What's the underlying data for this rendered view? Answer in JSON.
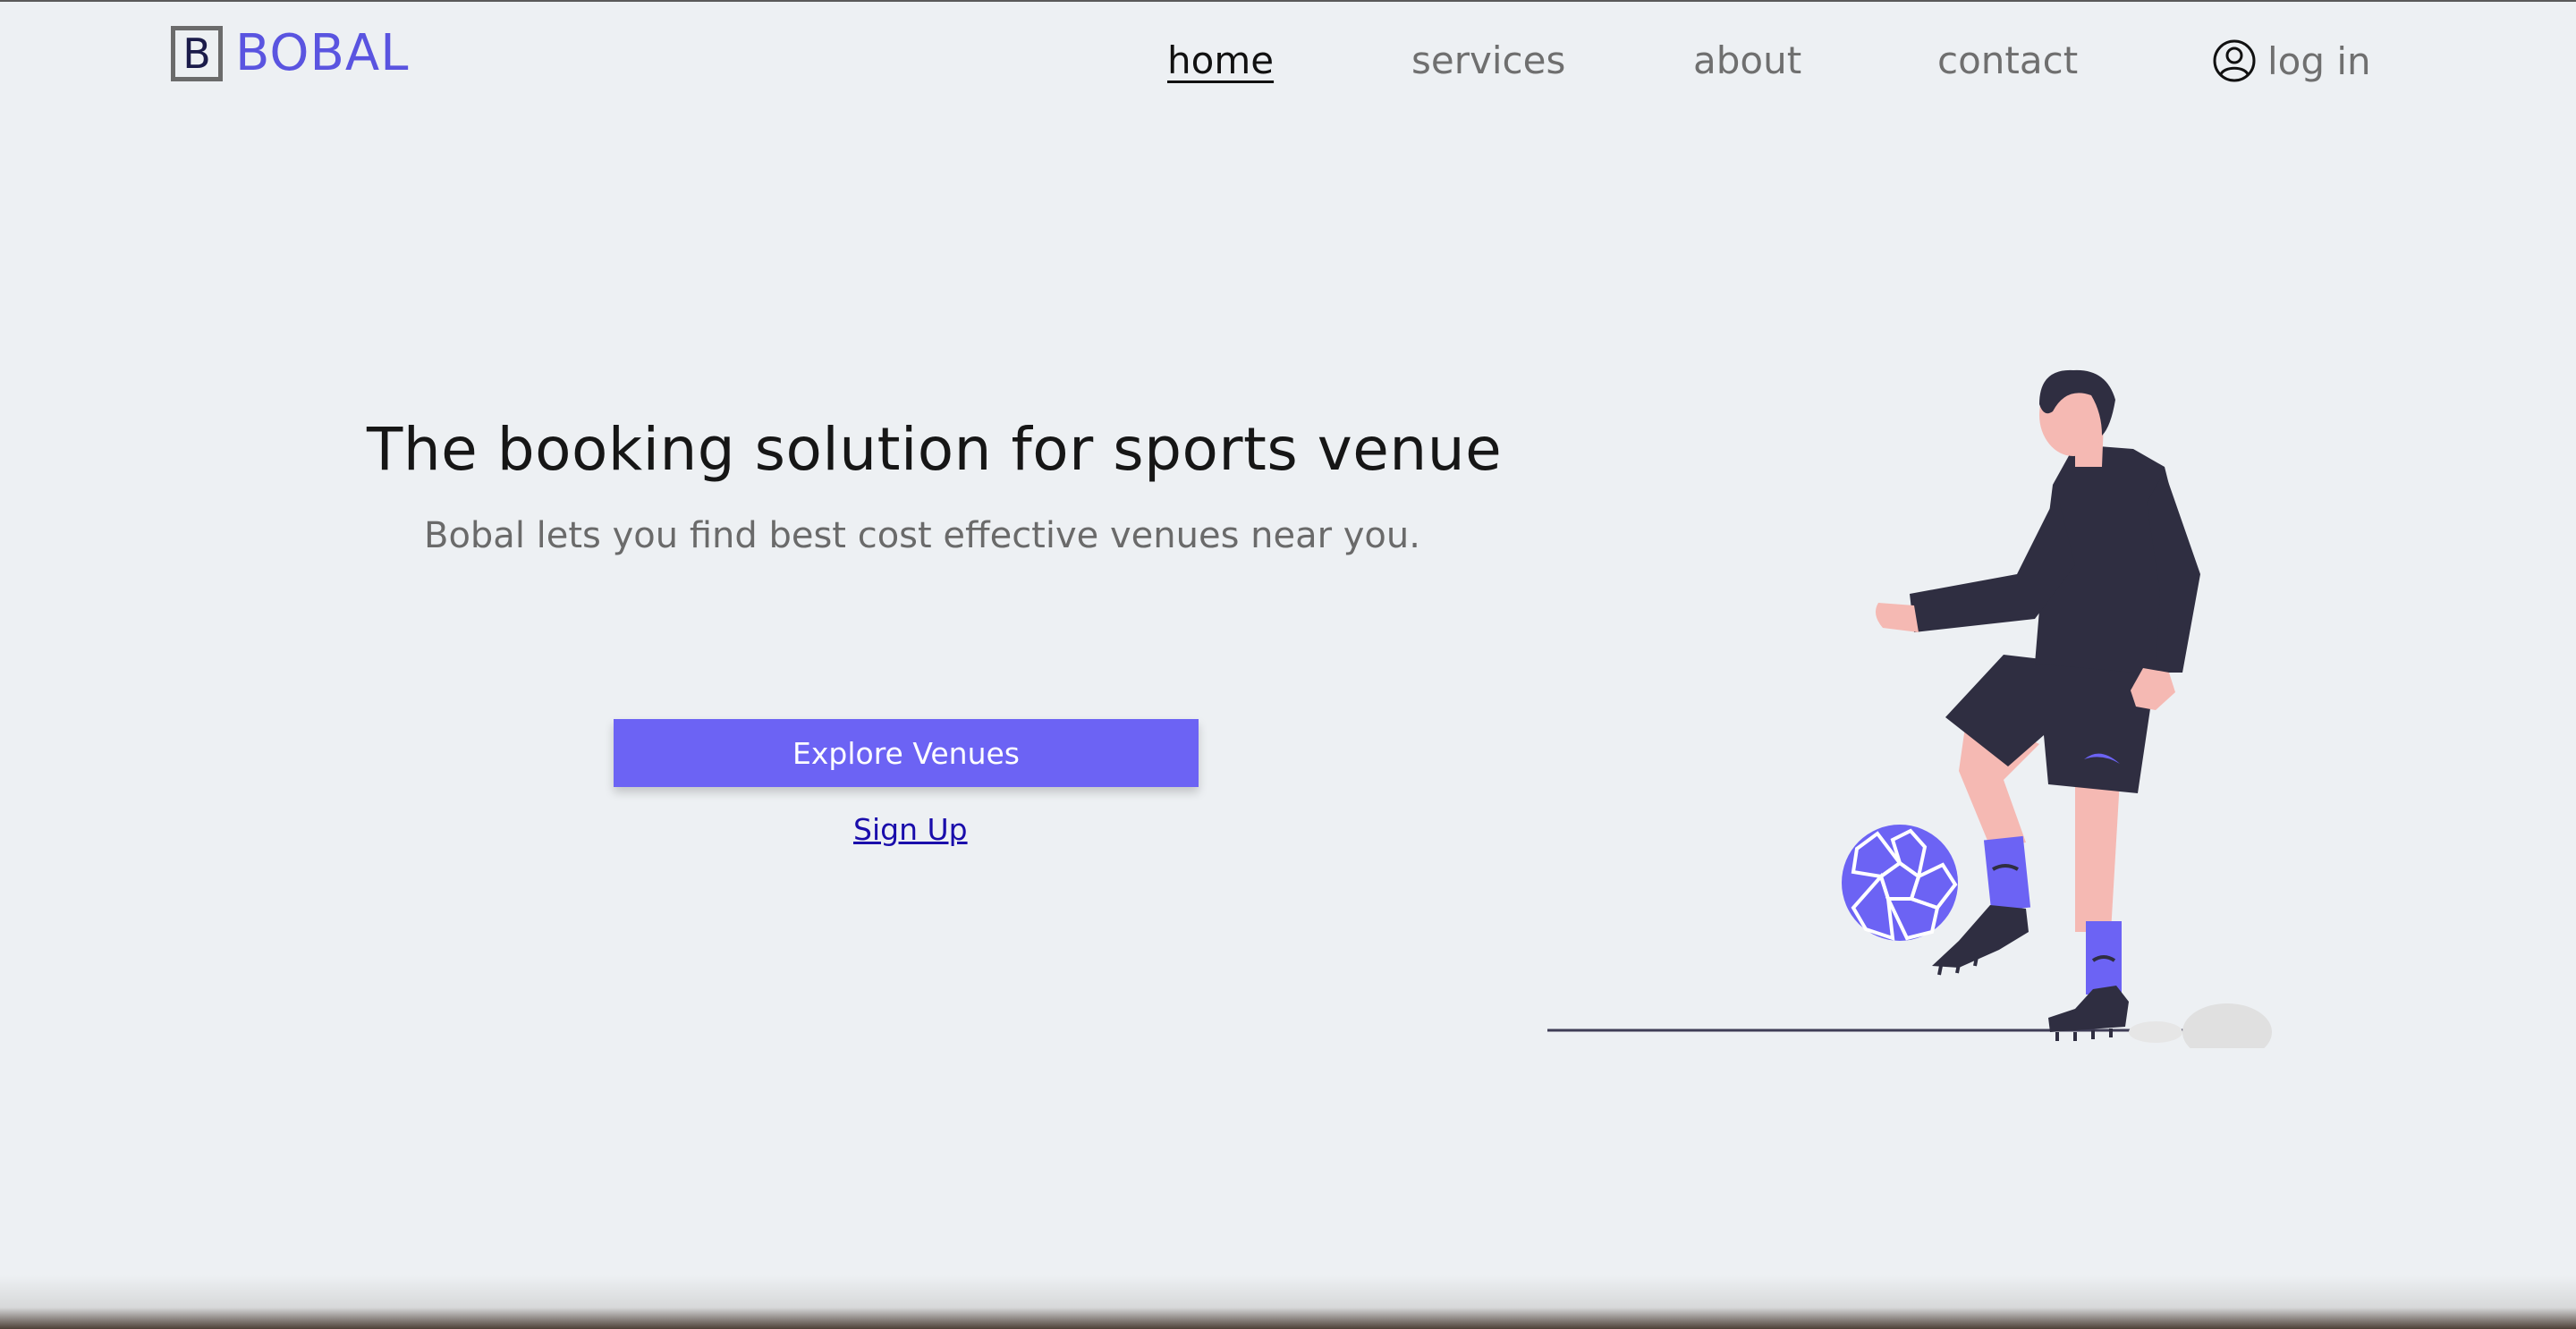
{
  "brand": {
    "logo_letter": "B",
    "name": "BOBAL",
    "color": "#5a54e0"
  },
  "nav": {
    "home": "home",
    "services": "services",
    "about": "about",
    "contact": "contact",
    "login": "log in",
    "login_icon": "user-circle-icon",
    "active": "home"
  },
  "hero": {
    "title": "The booking solution for sports venue",
    "subtitle": "Bobal lets you find best cost effective venues near you.",
    "cta_label": "Explore Venues",
    "cta_color": "#6c63f4",
    "signup_label": "Sign Up"
  },
  "illustration": {
    "subject": "soccer-player-illustration",
    "accent": "#6c63f4",
    "clothing": "#2f2e41",
    "skin": "#f5b9b3"
  }
}
